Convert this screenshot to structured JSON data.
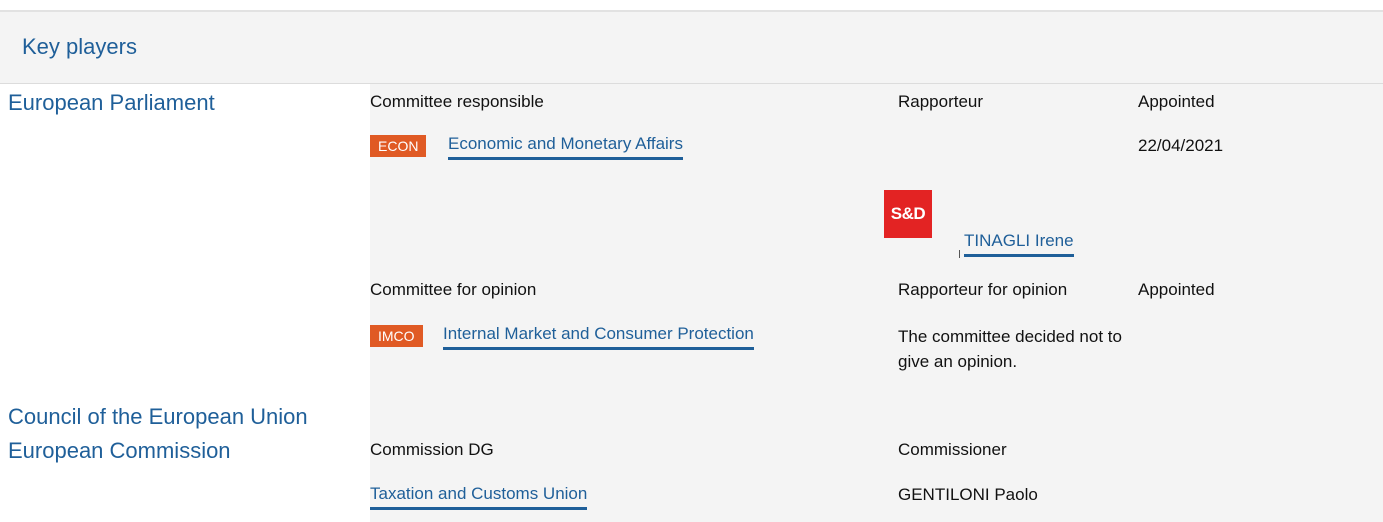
{
  "section": {
    "title": "Key players"
  },
  "institutions": {
    "parliament": "European Parliament",
    "council": "Council of the European Union",
    "commission": "European Commission"
  },
  "parliament": {
    "responsible": {
      "header_committee": "Committee responsible",
      "header_rapporteur": "Rapporteur",
      "header_appointed": "Appointed",
      "badge": "ECON",
      "committee_name": "Economic and Monetary Affairs",
      "appointed_date": "22/04/2021",
      "party_logo": "S&D",
      "rapporteur_name": "TINAGLI Irene"
    },
    "opinion": {
      "header_committee": "Committee for opinion",
      "header_rapporteur": "Rapporteur for opinion",
      "header_appointed": "Appointed",
      "badge": "IMCO",
      "committee_name": "Internal Market and Consumer Protection",
      "note": "The committee decided not to give an opinion."
    }
  },
  "commission": {
    "header_dg": "Commission DG",
    "header_commissioner": "Commissioner",
    "dg_name": "Taxation and Customs Union",
    "commissioner_name": "GENTILONI Paolo"
  },
  "colors": {
    "link": "#1f5f99",
    "badge": "#e05a24",
    "sd_logo": "#e32323",
    "panel_bg": "#f4f4f4"
  }
}
